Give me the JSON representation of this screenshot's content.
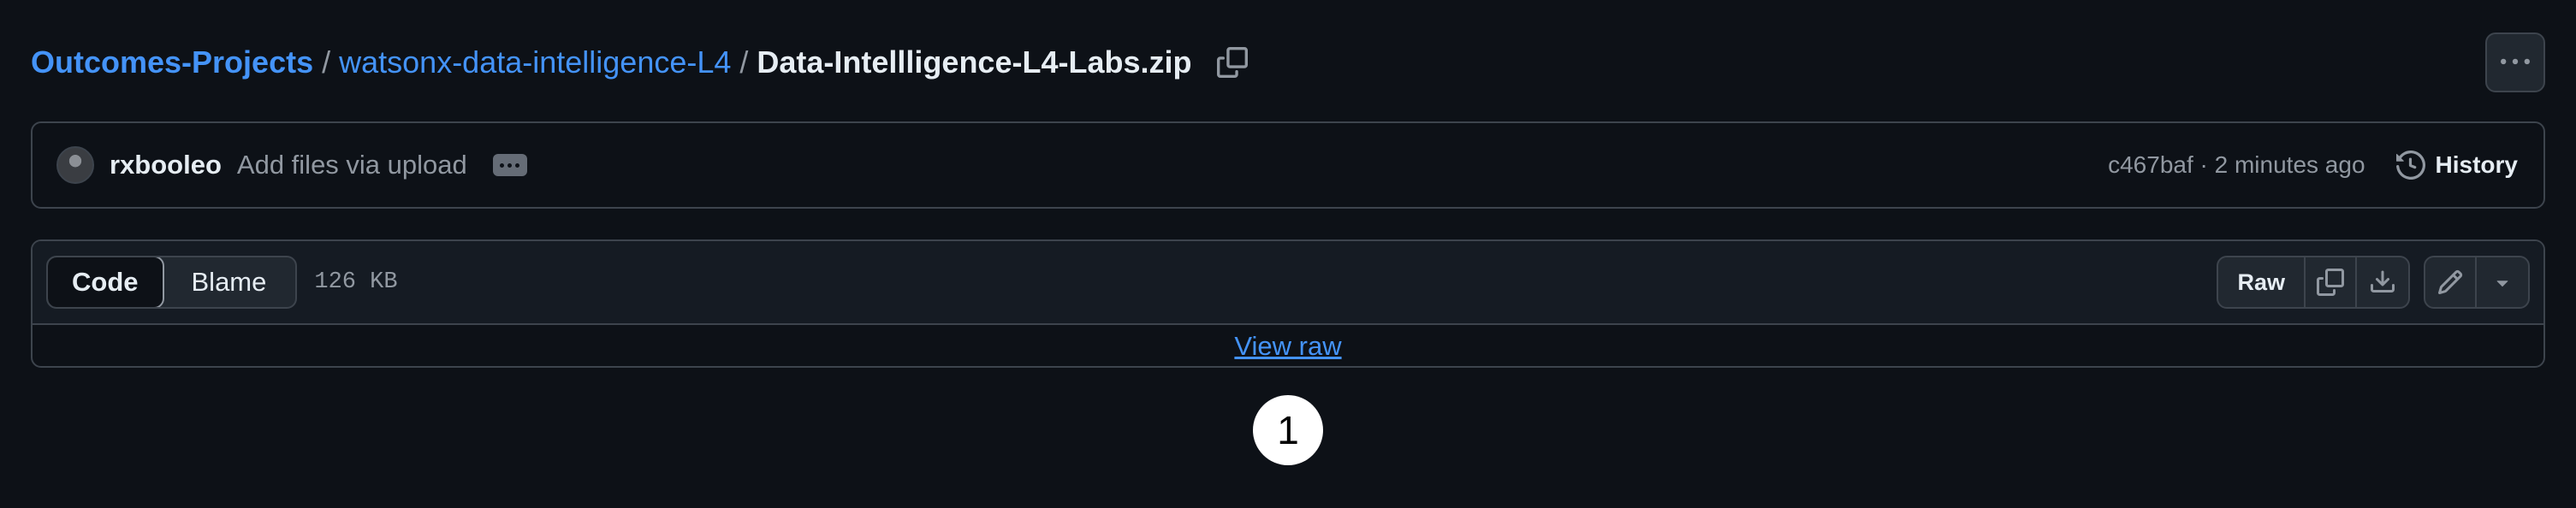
{
  "breadcrumb": {
    "owner": "Outcomes-Projects",
    "sep1": "/",
    "repo": "watsonx-data-intelligence-L4",
    "sep2": "/",
    "file": "Data-Intellligence-L4-Labs.zip"
  },
  "icons": {
    "copy_path": "copy-icon",
    "more": "kebab-horizontal-icon",
    "history": "history-icon",
    "copy_raw": "copy-icon",
    "download": "download-icon",
    "edit": "pencil-icon",
    "dropdown": "triangle-down-icon"
  },
  "commit": {
    "author": "rxbooleo",
    "message": "Add files via upload",
    "meta": "c467baf · 2 minutes ago",
    "history_label": "History"
  },
  "file_view": {
    "tabs": [
      {
        "label": "Code",
        "active": true
      },
      {
        "label": "Blame",
        "active": false
      }
    ],
    "size": "126 KB",
    "raw_label": "Raw",
    "view_raw_label": "View raw"
  },
  "marker": {
    "label": "1"
  },
  "colors": {
    "background": "#0d1117",
    "link": "#4493f8",
    "border": "#3d444d",
    "muted": "#9198a1"
  }
}
